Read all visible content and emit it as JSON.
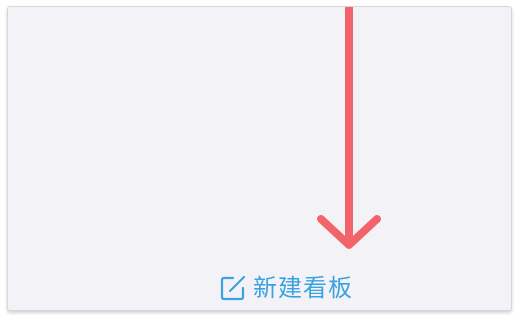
{
  "new_board": {
    "label": "新建看板",
    "icon": "edit-icon",
    "color": "#3aa3df"
  },
  "annotation": {
    "icon": "arrow-down-icon",
    "color": "#f2646a"
  },
  "colors": {
    "background": "#f3f3f7"
  }
}
